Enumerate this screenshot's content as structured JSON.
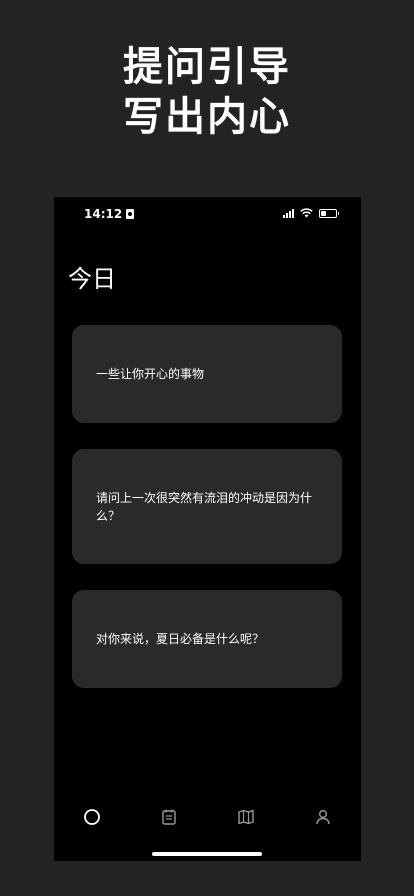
{
  "promo": {
    "line1": "提问引导",
    "line2": "写出内心"
  },
  "status_bar": {
    "time": "14:12",
    "battery_level": 0.35
  },
  "page": {
    "title": "今日"
  },
  "prompts": [
    "一些让你开心的事物",
    "请问上一次很突然有流泪的冲动是因为什么？",
    "对你来说，夏日必备是什么呢？"
  ],
  "tab_bar": {
    "items": [
      "circle-icon",
      "calendar-icon",
      "map-icon",
      "person-icon"
    ],
    "selected": "circle-icon"
  },
  "colors": {
    "outer_background": "#232325",
    "phone_background": "#000000",
    "card_background": "#2a2a2c",
    "text": "#ffffff"
  }
}
